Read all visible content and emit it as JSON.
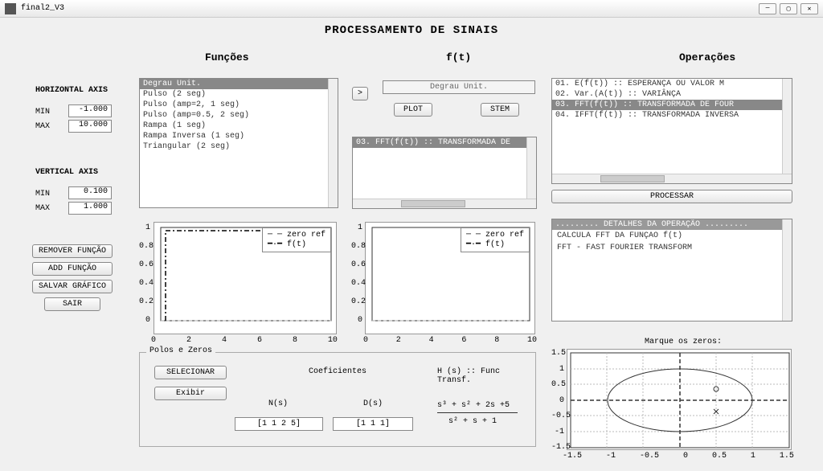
{
  "window": {
    "title": "final2_V3"
  },
  "main_title": "PROCESSAMENTO DE SINAIS",
  "columns": {
    "funcoes": "Funções",
    "ft": "f(t)",
    "operacoes": "Operações"
  },
  "haxis": {
    "label": "HORIZONTAL AXIS",
    "min_label": "MIN",
    "max_label": "MAX",
    "min": "-1.000",
    "max": "10.000"
  },
  "vaxis": {
    "label": "VERTICAL AXIS",
    "min_label": "MIN",
    "max_label": "MAX",
    "min": "0.100",
    "max": "1.000"
  },
  "funclist": {
    "items": [
      "Degrau Unit.",
      "Pulso (2 seg)",
      "Pulso (amp=2, 1 seg)",
      "Pulso (amp=0.5, 2 seg)",
      "Rampa (1 seg)",
      "Rampa Inversa (1 seg)",
      "Triangular (2 seg)"
    ],
    "selected": 0
  },
  "buttons": {
    "remover": "REMOVER FUNÇÃO",
    "add": "ADD FUNÇÃO",
    "salvar": "SALVAR GRÁFICO",
    "sair": "SAIR",
    "arrow": ">",
    "plot": "PLOT",
    "stem": "STEM",
    "selecionar": "SELECIONAR",
    "exibir": "Exibir",
    "processar": "PROCESSAR"
  },
  "ft_display": "Degrau Unit.",
  "ft_selection": "03. FFT(f(t))        :: TRANSFORMADA DE",
  "oplist": {
    "items": [
      "01. E(f(t))          :: ESPERANÇA OU VALOR M",
      "02. Var.(A(t))       :: VARIÂNÇA",
      "03. FFT(f(t))        :: TRANSFORMADA DE FOUR",
      "04. IFFT(f(t))       :: TRANSFORMADA INVERSA"
    ],
    "selected": 2
  },
  "details": {
    "title": "......... DETALHES DA OPERAÇÃO .........",
    "line1": "CALCULA FFT DA FUNÇAO f(t)",
    "line2": "FFT - FAST FOURIER TRANSFORM"
  },
  "plot_legend": {
    "zero": "zero ref",
    "ft": "f(t)"
  },
  "poloszeros": {
    "title": "Polos e Zeros",
    "coeficientes": "Coeficientes",
    "hs": "H (s) :: Func Transf.",
    "ns_label": "N(s)",
    "ds_label": "D(s)",
    "ns": "[1 1 2 5]",
    "ds": "[1 1 1]",
    "hs_num": "s³ + s² + 2s +5",
    "hs_den": "s² + s + 1"
  },
  "zeros_title": "Marque os zeros:",
  "chart_data": [
    {
      "type": "line",
      "title": "",
      "xlim": [
        0,
        10
      ],
      "ylim": [
        0,
        1
      ],
      "xticks": [
        0,
        2,
        4,
        6,
        8,
        10
      ],
      "yticks": [
        0,
        0.2,
        0.4,
        0.6,
        0.8,
        1
      ],
      "series": [
        {
          "name": "zero ref",
          "style": "dashed",
          "x": [
            0,
            10
          ],
          "y": [
            0,
            0
          ]
        },
        {
          "name": "f(t)",
          "style": "dashdot",
          "step": true,
          "x": [
            0,
            0,
            10
          ],
          "y": [
            0,
            1,
            1
          ]
        }
      ]
    },
    {
      "type": "line",
      "title": "",
      "xlim": [
        0,
        10
      ],
      "ylim": [
        0,
        1
      ],
      "xticks": [
        0,
        2,
        4,
        6,
        8,
        10
      ],
      "yticks": [
        0,
        0.2,
        0.4,
        0.6,
        0.8,
        1
      ],
      "series": [
        {
          "name": "zero ref",
          "style": "dashed",
          "x": [
            0,
            10
          ],
          "y": [
            0,
            0
          ]
        },
        {
          "name": "f(t)",
          "style": "dashdot",
          "x": [],
          "y": []
        }
      ]
    },
    {
      "type": "scatter",
      "title": "Marque os zeros:",
      "xlim": [
        -1.5,
        1.5
      ],
      "ylim": [
        -1.5,
        1.5
      ],
      "xticks": [
        -1.5,
        -1,
        -0.5,
        0,
        0.5,
        1,
        1.5
      ],
      "yticks": [
        -1.5,
        -1,
        -0.5,
        0,
        0.5,
        1,
        1.5
      ],
      "unit_circle": true,
      "points": [
        {
          "x": 0.5,
          "y": 0.35,
          "marker": "o"
        },
        {
          "x": 0.5,
          "y": -0.35,
          "marker": "x"
        }
      ]
    }
  ]
}
